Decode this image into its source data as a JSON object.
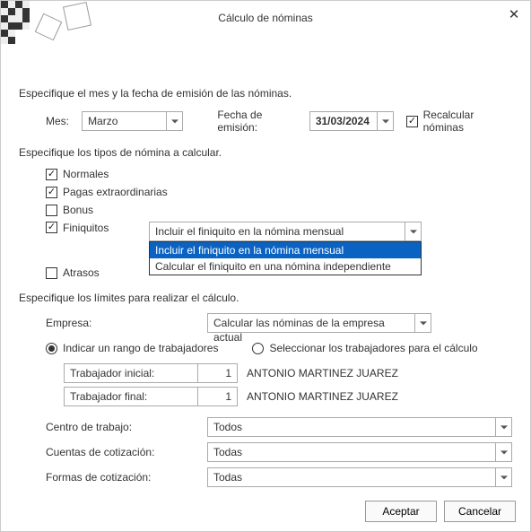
{
  "window": {
    "title": "Cálculo de nóminas"
  },
  "section1": {
    "heading": "Especifique el mes y la fecha de emisión de las nóminas.",
    "month_label": "Mes:",
    "month_value": "Marzo",
    "date_label": "Fecha de emisión:",
    "date_value": "31/03/2024",
    "recalc_label": "Recalcular nóminas"
  },
  "section2": {
    "heading": "Especifique los tipos de nómina a calcular.",
    "normales": "Normales",
    "pagas": "Pagas extraordinarias",
    "bonus": "Bonus",
    "finiquitos": "Finiquitos",
    "atrasos": "Atrasos",
    "finiquito_mode": "Incluir el finiquito en la nómina mensual",
    "finiquito_options": [
      "Incluir el finiquito en la nómina mensual",
      "Calcular el finiquito en una nómina independiente"
    ]
  },
  "section3": {
    "heading": "Especifique los límites para realizar el cálculo.",
    "empresa_label": "Empresa:",
    "empresa_value": "Calcular las nóminas de la empresa actual",
    "radio_range": "Indicar un rango de trabajadores",
    "radio_select": "Seleccionar los trabajadores para el cálculo",
    "worker_start_label": "Trabajador inicial:",
    "worker_end_label": "Trabajador final:",
    "worker_start_num": "1",
    "worker_end_num": "1",
    "worker_start_name": "ANTONIO MARTINEZ JUAREZ",
    "worker_end_name": "ANTONIO MARTINEZ JUAREZ",
    "centro_label": "Centro de trabajo:",
    "centro_value": "Todos",
    "cuentas_label": "Cuentas de cotización:",
    "cuentas_value": "Todas",
    "formas_label": "Formas de cotización:",
    "formas_value": "Todas"
  },
  "buttons": {
    "ok": "Aceptar",
    "cancel": "Cancelar"
  }
}
